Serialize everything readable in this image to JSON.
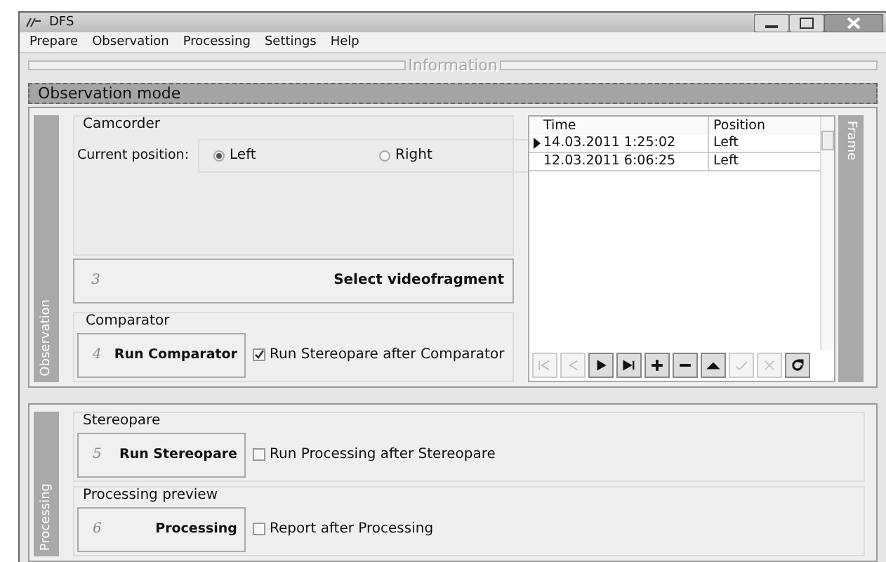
{
  "window": {
    "title": "DFS"
  },
  "menu": [
    {
      "label": "Prepare"
    },
    {
      "label": "Observation"
    },
    {
      "label": "Processing"
    },
    {
      "label": "Settings"
    },
    {
      "label": "Help"
    }
  ],
  "info_title": "Information",
  "mode_header": "Observation mode",
  "observation": {
    "tab_label": "Observation",
    "camcorder": {
      "title": "Camcorder",
      "position_label": "Current position:",
      "options": [
        {
          "label": "Left",
          "selected": true
        },
        {
          "label": "Right",
          "selected": false
        }
      ]
    },
    "select_button": {
      "step": "3",
      "label": "Select videofragment"
    },
    "comparator": {
      "title": "Comparator",
      "button": {
        "step": "4",
        "label": "Run Comparator"
      },
      "option": {
        "label": "Run Stereopare after Comparator",
        "checked": true
      }
    },
    "frame": {
      "tab_label": "Frame",
      "columns": [
        "Time",
        "Position"
      ],
      "rows": [
        {
          "current": true,
          "cells": [
            "14.03.2011 1:25:02",
            "Left"
          ]
        },
        {
          "current": false,
          "cells": [
            "12.03.2011 6:06:25",
            "Left"
          ]
        }
      ],
      "navigator": [
        {
          "kind": "first",
          "disabled": true
        },
        {
          "kind": "prior",
          "disabled": true
        },
        {
          "kind": "next",
          "disabled": false
        },
        {
          "kind": "last",
          "disabled": false
        },
        {
          "kind": "insert",
          "disabled": false
        },
        {
          "kind": "delete",
          "disabled": false
        },
        {
          "kind": "edit",
          "disabled": false
        },
        {
          "kind": "post",
          "disabled": true
        },
        {
          "kind": "cancel",
          "disabled": true
        },
        {
          "kind": "refresh",
          "disabled": false
        }
      ]
    }
  },
  "processing": {
    "tab_label": "Processing",
    "groups": [
      {
        "title": "Stereopare",
        "button": {
          "step": "5",
          "label": "Run Stereopare"
        },
        "option": {
          "label": "Run Processing after Stereopare",
          "checked": false
        }
      },
      {
        "title": "Processing preview",
        "button": {
          "step": "6",
          "label": "Processing"
        },
        "option": {
          "label": "Report after Processing",
          "checked": false
        }
      }
    ]
  }
}
